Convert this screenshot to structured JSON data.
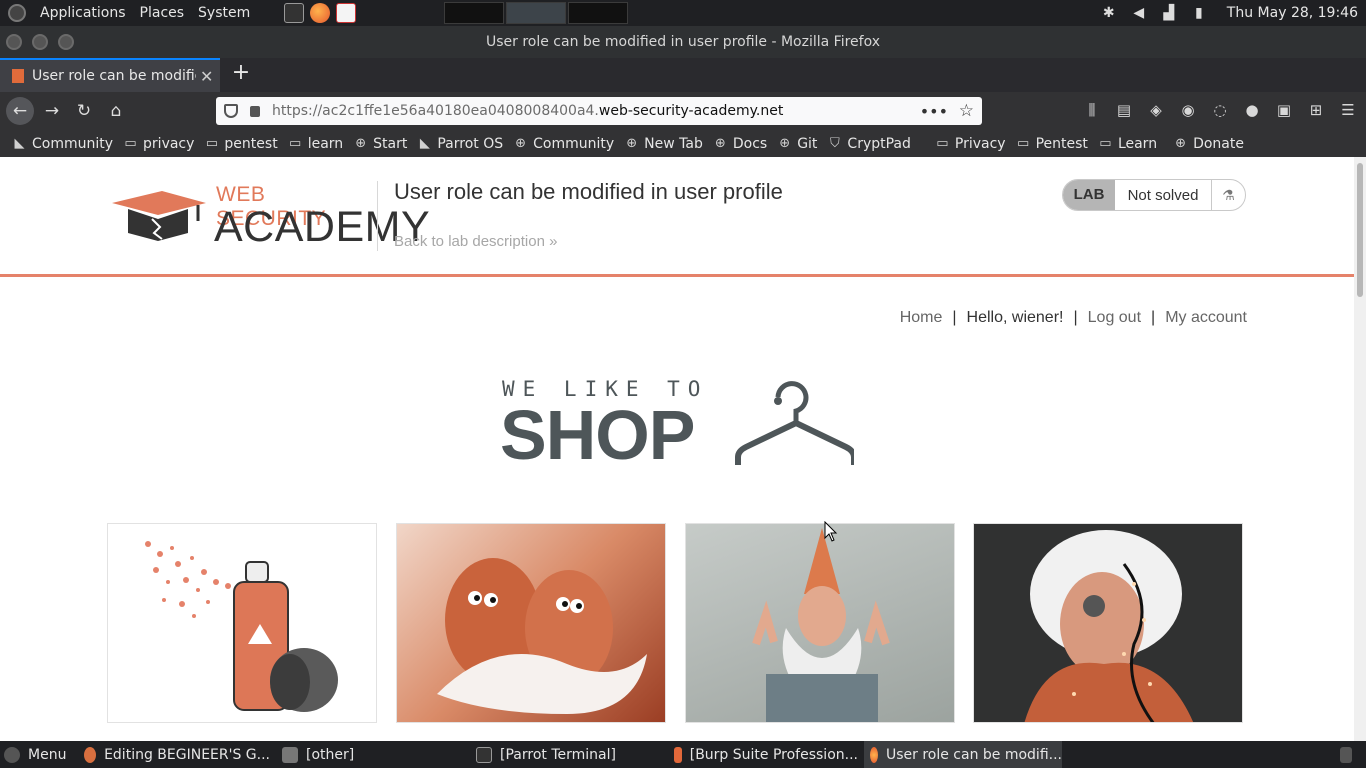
{
  "os_panel": {
    "menus": [
      "Applications",
      "Places",
      "System"
    ],
    "clock": "Thu May 28, 19:46"
  },
  "window": {
    "title": "User role can be modified in user profile - Mozilla Firefox"
  },
  "tab": {
    "title": "User role can be modified in user profile"
  },
  "url": {
    "prefix": "https://ac2c1ffe1e56a40180ea0408008400a4.",
    "domain": "web-security-academy.net"
  },
  "bookmarks": [
    {
      "label": "Community",
      "icon": "parrot-icon"
    },
    {
      "label": "privacy",
      "icon": "folder-icon"
    },
    {
      "label": "pentest",
      "icon": "folder-icon"
    },
    {
      "label": "learn",
      "icon": "folder-icon"
    },
    {
      "label": "Start",
      "icon": "globe-icon"
    },
    {
      "label": "Parrot OS",
      "icon": "parrot-icon"
    },
    {
      "label": "Community",
      "icon": "globe-icon"
    },
    {
      "label": "New Tab",
      "icon": "globe-icon"
    },
    {
      "label": "Docs",
      "icon": "globe-icon"
    },
    {
      "label": "Git",
      "icon": "globe-icon"
    },
    {
      "label": "CryptPad",
      "icon": "shield-icon"
    },
    {
      "label": "Privacy",
      "icon": "folder-icon"
    },
    {
      "label": "Pentest",
      "icon": "folder-icon"
    },
    {
      "label": "Learn",
      "icon": "folder-icon"
    },
    {
      "label": "Donate",
      "icon": "globe-icon"
    }
  ],
  "header": {
    "logo_top": "WEB SECURITY",
    "logo_bottom": "ACADEMY",
    "lab_title": "User role can be modified in user profile",
    "back_link": "Back to lab description",
    "lab_badge": "LAB",
    "lab_status": "Not solved"
  },
  "nav": {
    "home": "Home",
    "hello": "Hello, wiener!",
    "logout": "Log out",
    "account": "My account",
    "separator": "|"
  },
  "shop_logo": {
    "line1": "WE LIKE TO",
    "line2": "SHOP"
  },
  "taskbar": {
    "menu": "Menu",
    "tasks": [
      "Editing BEGINEER'S G...",
      "[other]",
      "[Parrot Terminal]",
      "[Burp Suite Profession...",
      "User role can be modifi..."
    ]
  },
  "colors": {
    "accent": "#e5826a",
    "firefox_dark": "#323234"
  }
}
